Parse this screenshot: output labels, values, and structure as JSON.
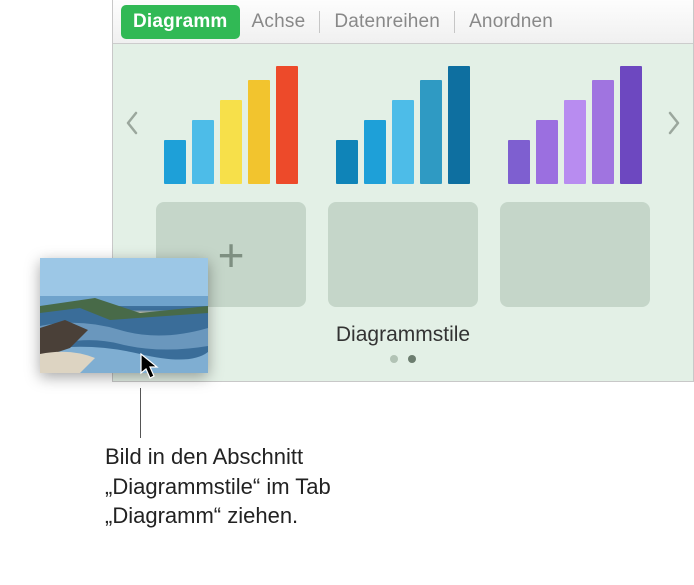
{
  "tabs": {
    "diagramm": "Diagramm",
    "achse": "Achse",
    "datenreihen": "Datenreihen",
    "anordnen": "Anordnen"
  },
  "section_title": "Diagrammstile",
  "callout": "Bild in den Abschnitt „Diagrammstile“ im Tab „Diagramm“ ziehen.",
  "styles": [
    {
      "colors": [
        "#1ea0d8",
        "#4dbce8",
        "#f7e04a",
        "#f2c42e",
        "#ed4a2a"
      ],
      "heights": [
        44,
        64,
        84,
        104,
        118
      ]
    },
    {
      "colors": [
        "#0f84b8",
        "#1ea0d8",
        "#4dbce8",
        "#2f9ac3",
        "#0e6fa0"
      ],
      "heights": [
        44,
        64,
        84,
        104,
        118
      ]
    },
    {
      "colors": [
        "#7e5fd0",
        "#9b6fe0",
        "#b88cf0",
        "#a074e0",
        "#6d48c0"
      ],
      "heights": [
        44,
        64,
        84,
        104,
        118
      ]
    }
  ]
}
